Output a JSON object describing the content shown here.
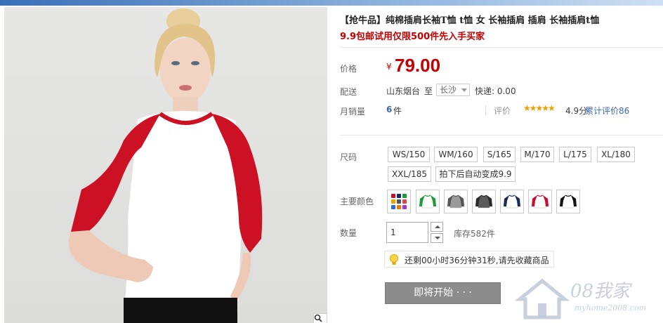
{
  "product": {
    "title": "【抢牛品】纯棉插肩长袖T恤 t恤 女 长袖插肩 插肩 长袖插肩t恤",
    "subtitle": "9.9包邮试用仅限500件先入手买家"
  },
  "price": {
    "label": "价格",
    "currency": "¥",
    "value": "79.00"
  },
  "shipping": {
    "label": "配送",
    "from": "山东烟台",
    "to_word": "至",
    "destination": "长沙",
    "express": "快递: 0.00"
  },
  "sales": {
    "label": "月销量",
    "count": "6",
    "unit": "件",
    "review_label": "评价",
    "stars": "★★★★★",
    "rating": "4.9分",
    "review_link": "累计评价86"
  },
  "size": {
    "label": "尺码",
    "options": [
      "WS/150",
      "WM/160",
      "S/165",
      "M/170",
      "L/175",
      "XL/180",
      "XXL/185",
      "拍下后自动变成9.9"
    ]
  },
  "color": {
    "label": "主要颜色",
    "swatches": [
      {
        "name": "multi-color",
        "body": "#ffffff",
        "sleeve": "#999999"
      },
      {
        "name": "green",
        "body": "#ffffff",
        "sleeve": "#1f9a3a"
      },
      {
        "name": "gray",
        "body": "#9a9a9a",
        "sleeve": "#555555"
      },
      {
        "name": "dark-gray",
        "body": "#5a5a5a",
        "sleeve": "#2a2a2a"
      },
      {
        "name": "navy",
        "body": "#ffffff",
        "sleeve": "#1e2a55"
      },
      {
        "name": "red",
        "body": "#ffffff",
        "sleeve": "#c8102e"
      },
      {
        "name": "black",
        "body": "#ffffff",
        "sleeve": "#111111"
      }
    ]
  },
  "quantity": {
    "label": "数量",
    "value": "1",
    "stock": "库存582件"
  },
  "notice": {
    "text": "还剩00小时36分钟31秒,请先收藏商品"
  },
  "cta": {
    "label": "即将开始 · · ·"
  },
  "watermark": {
    "text": "08我家",
    "url": "myhome2008.com"
  },
  "colors": {
    "accent": "#c40000",
    "link": "#3c6ab3",
    "star": "#f0a000"
  }
}
